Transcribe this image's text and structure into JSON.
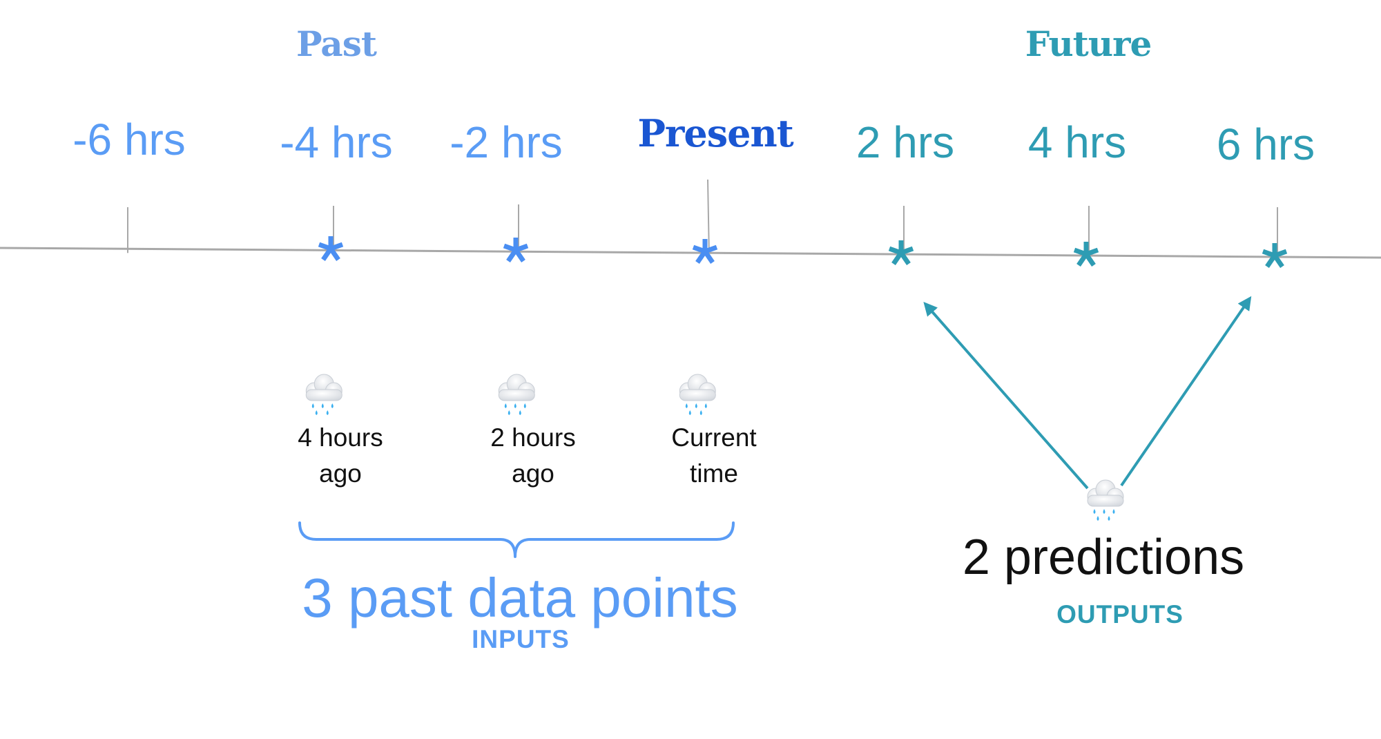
{
  "colors": {
    "past": "#5a9cf5",
    "past_header": "#6c9fe6",
    "present": "#1a56d2",
    "future": "#2e9cb3",
    "axis": "#a8a8a8",
    "text": "#111111"
  },
  "headers": {
    "past": "Past",
    "future": "Future"
  },
  "timeline": {
    "ticks": [
      {
        "label": "-6 hrs",
        "hours": -6,
        "group": "past",
        "marker": false
      },
      {
        "label": "-4 hrs",
        "hours": -4,
        "group": "past",
        "marker": true
      },
      {
        "label": "-2 hrs",
        "hours": -2,
        "group": "past",
        "marker": true
      },
      {
        "label": "Present",
        "hours": 0,
        "group": "present",
        "marker": true
      },
      {
        "label": "2 hrs",
        "hours": 2,
        "group": "future",
        "marker": true
      },
      {
        "label": "4 hrs",
        "hours": 4,
        "group": "future",
        "marker": true
      },
      {
        "label": "6 hrs",
        "hours": 6,
        "group": "future",
        "marker": true
      }
    ],
    "marker_glyph": "*"
  },
  "inputs": {
    "observations": [
      {
        "icon": "rain-cloud-icon",
        "line1": "4 hours",
        "line2": "ago"
      },
      {
        "icon": "rain-cloud-icon",
        "line1": "2 hours",
        "line2": "ago"
      },
      {
        "icon": "rain-cloud-icon",
        "line1": "Current",
        "line2": "time"
      }
    ],
    "summary": "3 past data points",
    "caption": "INPUTS"
  },
  "outputs": {
    "icon": "rain-cloud-icon",
    "summary": "2 predictions",
    "caption": "OUTPUTS",
    "targets": [
      "2 hrs",
      "6 hrs"
    ]
  }
}
